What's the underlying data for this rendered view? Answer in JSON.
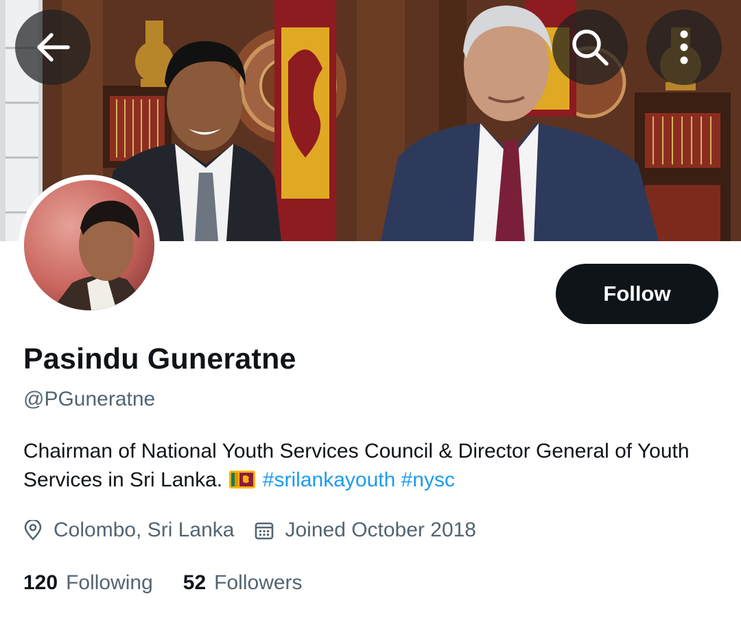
{
  "header": {
    "back_icon": "arrow-left-icon",
    "search_icon": "search-icon",
    "more_icon": "more-vertical-icon"
  },
  "profile": {
    "name": "Pasindu Guneratne",
    "handle": "@PGuneratne",
    "follow_label": "Follow",
    "bio": {
      "text": "Chairman of National Youth Services Council & Director General of Youth Services in Sri Lanka.",
      "flag": "🇱🇰",
      "hashtags": [
        "#srilankayouth",
        "#nysc"
      ]
    },
    "location": "Colombo, Sri Lanka",
    "joined": "Joined October 2018",
    "following_count": "120",
    "following_label": "Following",
    "followers_count": "52",
    "followers_label": "Followers"
  },
  "colors": {
    "text_primary": "#0f1419",
    "text_secondary": "#536471",
    "link": "#1d9bf0",
    "button_dark": "#0f1419"
  }
}
